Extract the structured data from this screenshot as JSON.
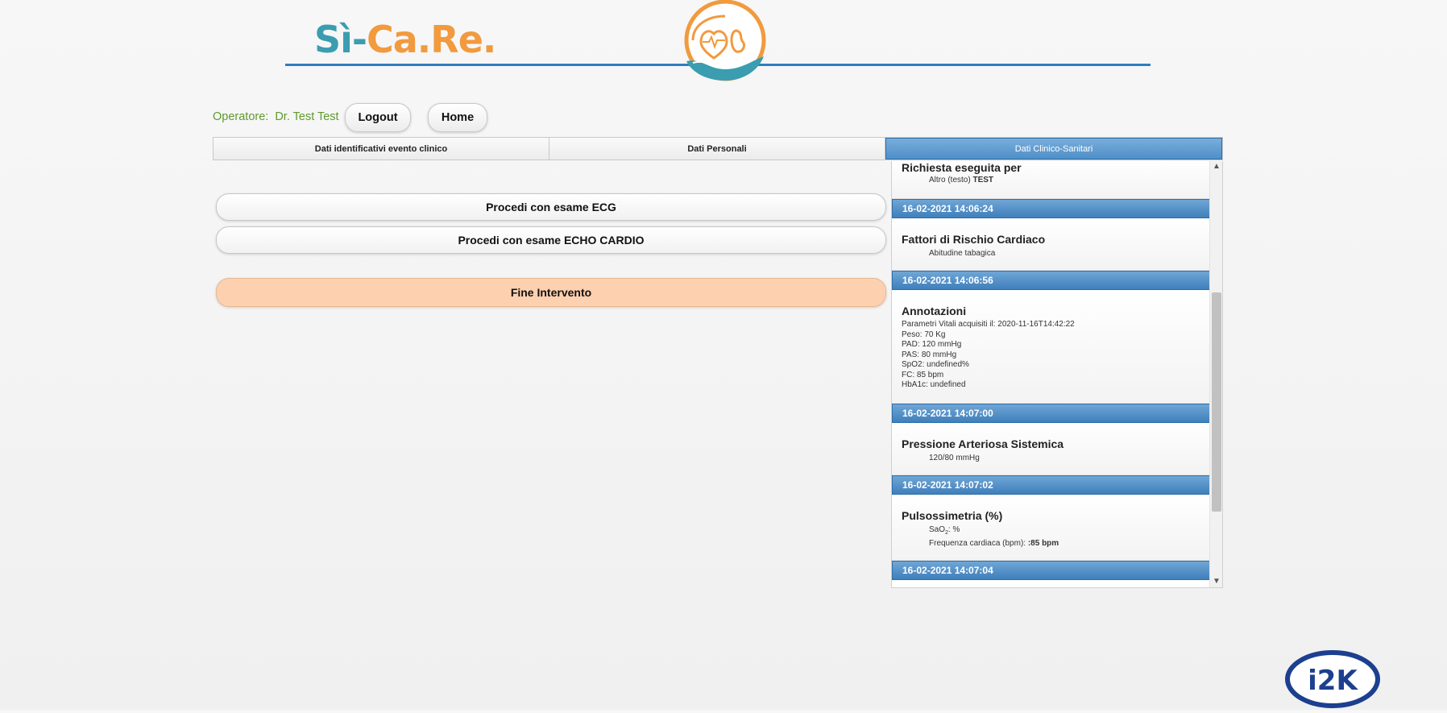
{
  "header": {
    "logo_text_si": "Sì-",
    "logo_text_care": "Ca.Re.",
    "brand_colors": {
      "teal": "#3a9db0",
      "orange": "#f19a3e",
      "line": "#2f7dbf"
    }
  },
  "operator": {
    "label": "Operatore:",
    "name": "Dr. Test Test",
    "logout_label": "Logout",
    "home_label": "Home"
  },
  "tabs": [
    {
      "label": "Dati identificativi evento clinico",
      "active": false
    },
    {
      "label": "Dati Personali",
      "active": false
    },
    {
      "label": "Dati Clinico-Sanitari",
      "active": true
    }
  ],
  "actions": {
    "ecg_label": "Procedi con esame ECG",
    "echo_label": "Procedi con esame ECHO CARDIO",
    "fine_label": "Fine Intervento"
  },
  "timeline": {
    "first": {
      "title": "Richiesta eseguita per",
      "sub_prefix": "Altro (testo)",
      "sub_value": "TEST"
    },
    "entries": [
      {
        "timestamp": "16-02-2021 14:06:24",
        "title": "Fattori di Rischio Cardiaco",
        "sub": "Abitudine tabagica"
      },
      {
        "timestamp": "16-02-2021 14:06:56",
        "title": "Annotazioni",
        "lines": [
          "Parametri Vitali acquisiti il: 2020-11-16T14:42:22",
          "Peso: 70 Kg",
          "PAD: 120 mmHg",
          "PAS: 80 mmHg",
          "SpO2: undefined%",
          "FC: 85 bpm",
          "HbA1c: undefined"
        ]
      },
      {
        "timestamp": "16-02-2021 14:07:00",
        "title": "Pressione Arteriosa Sistemica",
        "sub": "120/80 mmHg"
      },
      {
        "timestamp": "16-02-2021 14:07:02",
        "title": "Pulsossimetria (%)",
        "sao2_label": "SaO",
        "sao2_sub": "2",
        "sao2_value": ": %",
        "fc_label": "Frequenza cardiaca (bpm):",
        "fc_value": ":85 bpm"
      },
      {
        "timestamp": "16-02-2021 14:07:04"
      }
    ]
  },
  "footer": {
    "logo_text": "i2K"
  }
}
